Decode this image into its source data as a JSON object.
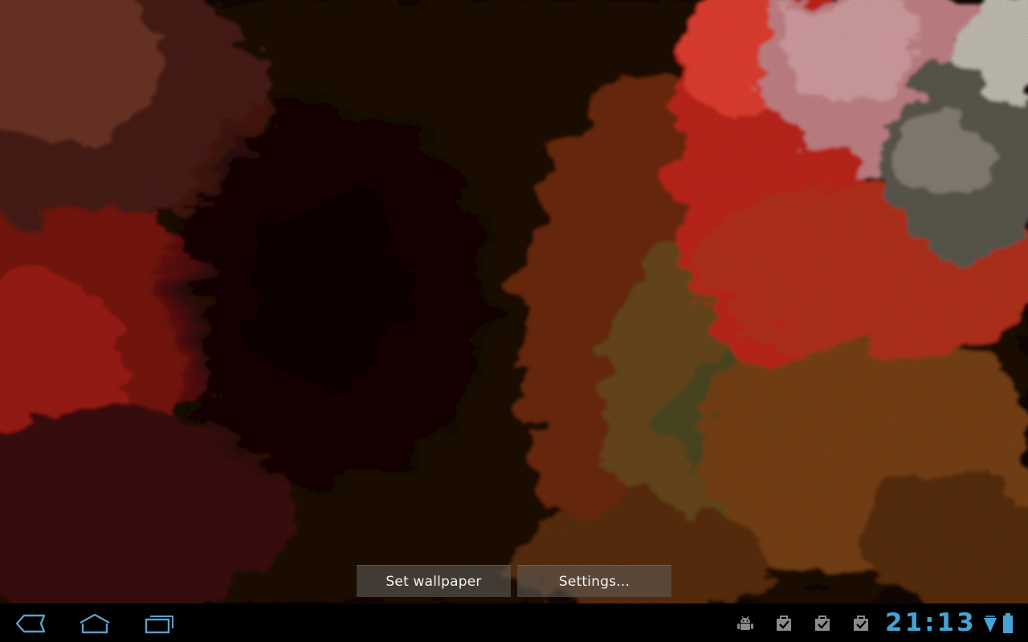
{
  "wallpaper_preview": {
    "set_wallpaper_label": "Set wallpaper",
    "settings_label": "Settings..."
  },
  "system_bar": {
    "nav_buttons": [
      "back-icon",
      "home-icon",
      "recent-apps-icon"
    ],
    "notification_icons": [
      "android-debug-icon",
      "download-complete-icon",
      "download-complete-icon",
      "download-complete-icon"
    ],
    "clock": "21:13",
    "status_icons": [
      "wifi-signal-icon",
      "battery-icon"
    ],
    "accent_color": "#47a3d4"
  }
}
